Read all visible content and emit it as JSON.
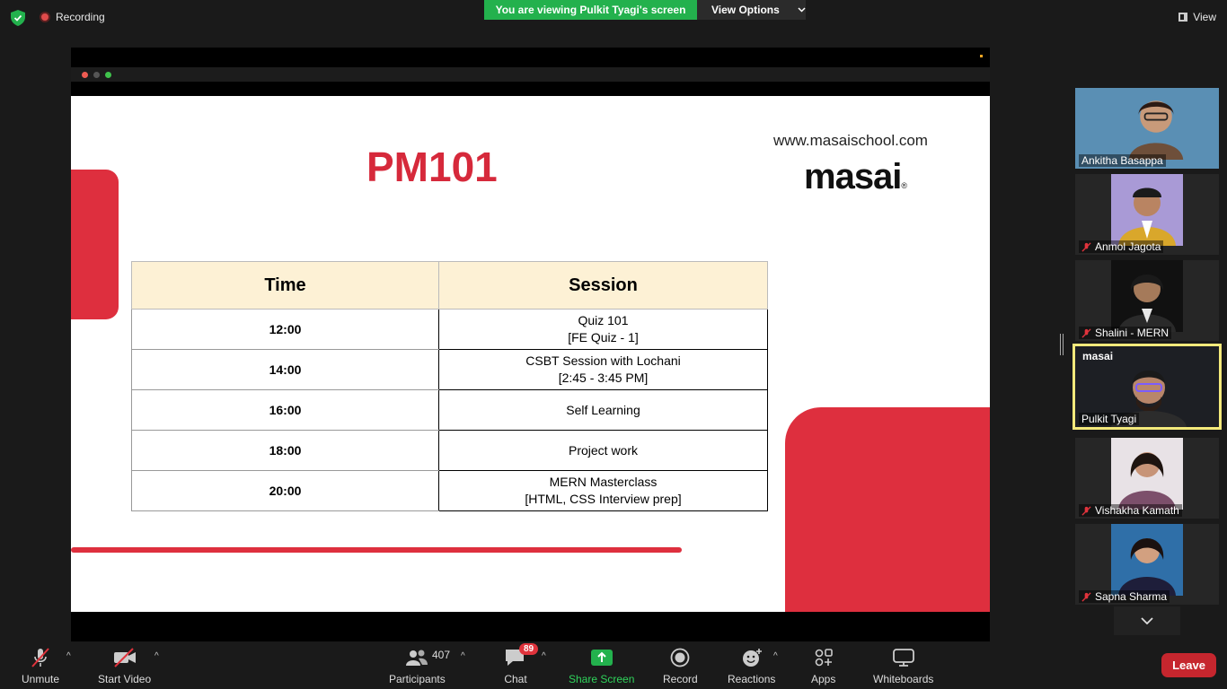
{
  "topbar": {
    "recording_label": "Recording",
    "viewing_banner": "You are viewing Pulkit Tyagi's screen",
    "view_options": "View Options",
    "view_label": "View"
  },
  "slide": {
    "title": "PM101",
    "url": "www.masaischool.com",
    "logo_text": "masai",
    "logo_mark": "®",
    "table": {
      "headers": [
        "Time",
        "Session"
      ],
      "rows": [
        {
          "time": "12:00",
          "line1": "Quiz 101",
          "line2": "[FE Quiz - 1]"
        },
        {
          "time": "14:00",
          "line1": "CSBT Session with Lochani",
          "line2": "[2:45 - 3:45 PM]"
        },
        {
          "time": "16:00",
          "line1": "Self Learning",
          "line2": ""
        },
        {
          "time": "18:00",
          "line1": "Project work",
          "line2": ""
        },
        {
          "time": "20:00",
          "line1": "MERN Masterclass",
          "line2": "[HTML, CSS Interview prep]"
        }
      ]
    }
  },
  "participants_panel": [
    {
      "name": "Ankitha Basappa",
      "muted": false
    },
    {
      "name": "Anmol Jagota",
      "muted": true
    },
    {
      "name": "Shalini - MERN",
      "muted": true
    },
    {
      "name": "Pulkit Tyagi",
      "muted": false,
      "watermark": "masai"
    },
    {
      "name": "Vishakha Kamath",
      "muted": true
    },
    {
      "name": "Sapna Sharma",
      "muted": true
    }
  ],
  "toolbar": {
    "unmute": "Unmute",
    "start_video": "Start Video",
    "participants": "Participants",
    "participant_count": "407",
    "chat": "Chat",
    "chat_badge": "89",
    "share_screen": "Share Screen",
    "record": "Record",
    "reactions": "Reactions",
    "apps": "Apps",
    "whiteboards": "Whiteboards",
    "leave": "Leave"
  },
  "colors": {
    "accent_green": "#23b14d",
    "brand_red": "#de2f3e",
    "leave_red": "#c6262e",
    "active_speaker": "#f3e97b"
  }
}
